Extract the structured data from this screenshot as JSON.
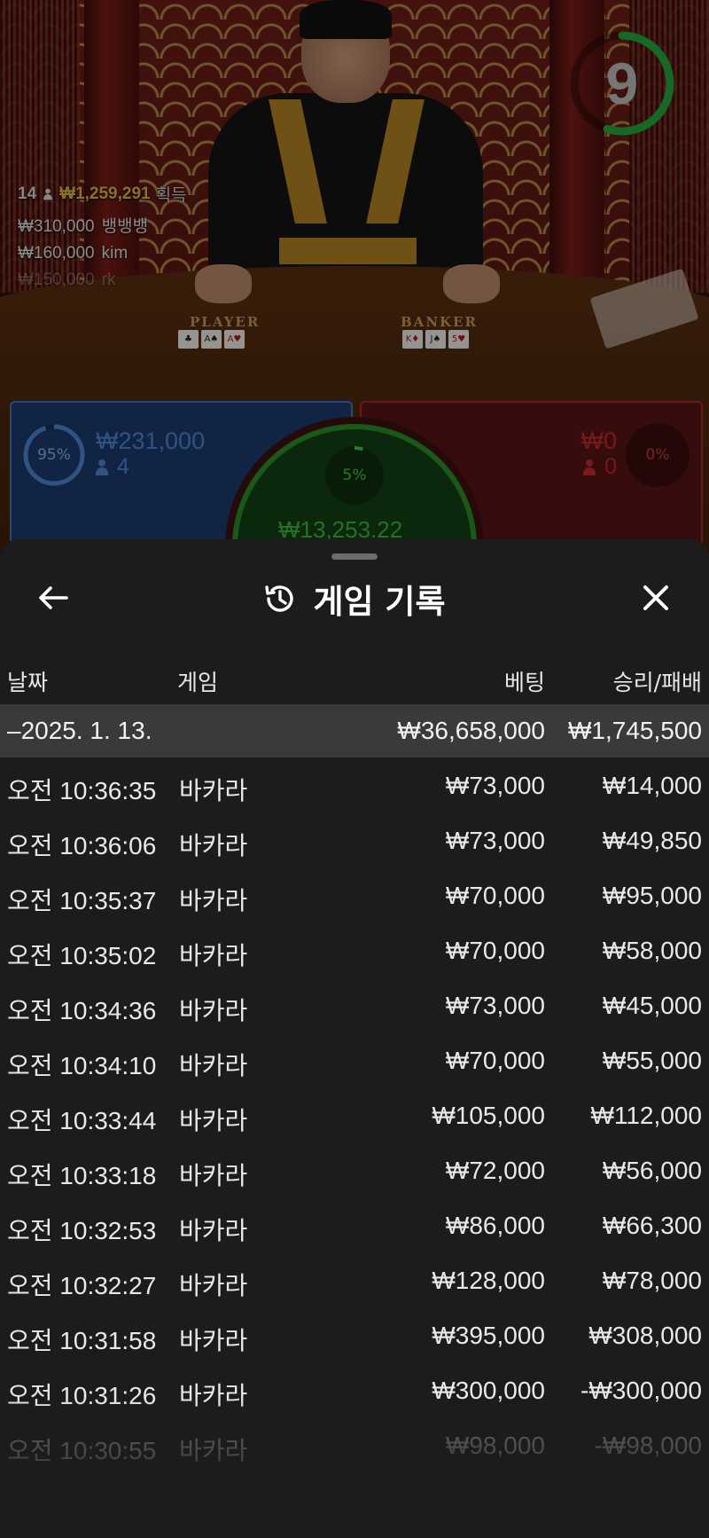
{
  "colors": {
    "player": "#3f74c7",
    "banker": "#a62a2a",
    "tie": "#2b8e2b",
    "timer": "#24a83a",
    "winner_amount": "#d9b845",
    "sheet_bg": "#1c1c1c",
    "date_row_bg": "#3a3a3a"
  },
  "live": {
    "timer": "9",
    "timer_fraction": 0.55,
    "player_label": "PLAYER",
    "banker_label": "BANKER",
    "player_cards": [
      "♣",
      "A♠",
      "A♥"
    ],
    "banker_cards": [
      "K♦",
      "J♠",
      "5♥"
    ],
    "winners": {
      "count": "14",
      "amount": "₩1,259,291",
      "label": "획득",
      "rows": [
        {
          "amount": "₩310,000",
          "name": "뱅뱅뱅"
        },
        {
          "amount": "₩160,000",
          "name": "kim"
        },
        {
          "amount": "₩150,000",
          "name": "rk"
        }
      ]
    },
    "player_bet": {
      "percent": "95%",
      "percent_value": 95,
      "amount": "₩231,000",
      "count": "4"
    },
    "banker_bet": {
      "percent": "0%",
      "percent_value": 0,
      "amount": "₩0",
      "count": "0"
    },
    "tie_bet": {
      "percent": "5%",
      "percent_value": 5,
      "amount": "₩13,253.22"
    }
  },
  "sheet": {
    "title": "게임 기록",
    "back_icon": "arrow-left-icon",
    "history_icon": "history-icon",
    "close_icon": "close-icon",
    "columns": {
      "date": "날짜",
      "game": "게임",
      "bet": "베팅",
      "winloss": "승리/패배"
    },
    "date_group": {
      "date": "–2025. 1. 13.",
      "bet_total": "₩36,658,000",
      "winloss_total": "₩1,745,500"
    },
    "rows": [
      {
        "time": "오전 10:36:35",
        "game": "바카라",
        "bet": "₩73,000",
        "winloss": "₩14,000"
      },
      {
        "time": "오전 10:36:06",
        "game": "바카라",
        "bet": "₩73,000",
        "winloss": "₩49,850"
      },
      {
        "time": "오전 10:35:37",
        "game": "바카라",
        "bet": "₩70,000",
        "winloss": "₩95,000"
      },
      {
        "time": "오전 10:35:02",
        "game": "바카라",
        "bet": "₩70,000",
        "winloss": "₩58,000"
      },
      {
        "time": "오전 10:34:36",
        "game": "바카라",
        "bet": "₩73,000",
        "winloss": "₩45,000"
      },
      {
        "time": "오전 10:34:10",
        "game": "바카라",
        "bet": "₩70,000",
        "winloss": "₩55,000"
      },
      {
        "time": "오전 10:33:44",
        "game": "바카라",
        "bet": "₩105,000",
        "winloss": "₩112,000"
      },
      {
        "time": "오전 10:33:18",
        "game": "바카라",
        "bet": "₩72,000",
        "winloss": "₩56,000"
      },
      {
        "time": "오전 10:32:53",
        "game": "바카라",
        "bet": "₩86,000",
        "winloss": "₩66,300"
      },
      {
        "time": "오전 10:32:27",
        "game": "바카라",
        "bet": "₩128,000",
        "winloss": "₩78,000"
      },
      {
        "time": "오전 10:31:58",
        "game": "바카라",
        "bet": "₩395,000",
        "winloss": "₩308,000"
      },
      {
        "time": "오전 10:31:26",
        "game": "바카라",
        "bet": "₩300,000",
        "winloss": "-₩300,000"
      },
      {
        "time": "오전 10:30:55",
        "game": "바카라",
        "bet": "₩98,000",
        "winloss": "-₩98,000"
      }
    ]
  }
}
